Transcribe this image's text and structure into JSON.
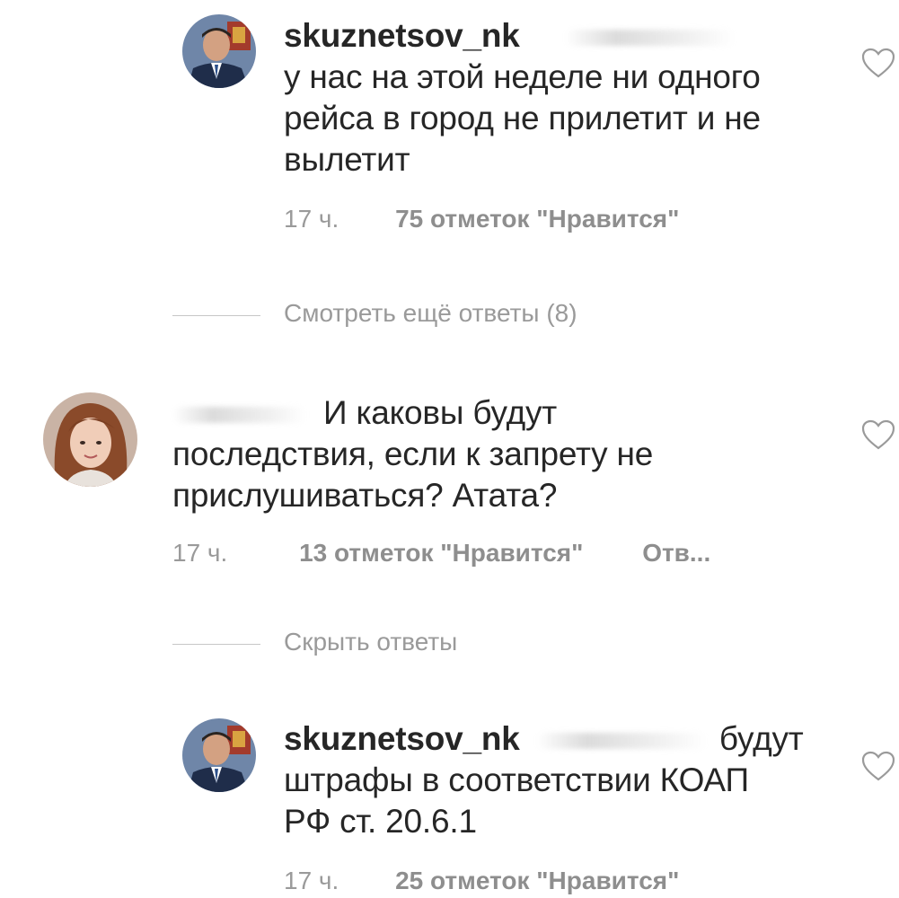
{
  "comments": [
    {
      "username": "skuznetsov_nk",
      "text_line1": "у нас на этой неделе ни одного",
      "text_line2": "рейса в город не прилетит и не",
      "text_line3": "вылетит",
      "time": "17 ч.",
      "likes": "75 отметок \"Нравится\"",
      "avatar_icon": "man-in-suit-avatar"
    },
    {
      "text_line1": "И каковы будут",
      "text_line2": "последствия, если к запрету не",
      "text_line3": "прислушиваться? Атата?",
      "time": "17 ч.",
      "likes": "13 отметок \"Нравится\"",
      "reply": "Отв...",
      "avatar_icon": "woman-avatar"
    },
    {
      "username": "skuznetsov_nk",
      "text_line1_tail": "будут",
      "text_line2": "штрафы в соответствии КОАП",
      "text_line3": "РФ ст. 20.6.1",
      "time": "17 ч.",
      "likes": "25 отметок \"Нравится\"",
      "avatar_icon": "man-in-suit-avatar"
    }
  ],
  "view_more_replies": "Смотреть ещё ответы (8)",
  "hide_replies": "Скрыть ответы",
  "icons": {
    "like": "heart-outline-icon"
  },
  "colors": {
    "text": "#262626",
    "meta": "#9a9a9a",
    "divider": "#c7c7c7"
  }
}
